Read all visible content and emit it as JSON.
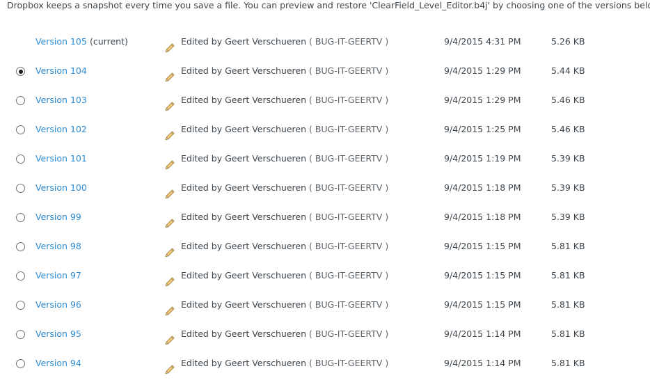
{
  "intro_text": "Dropbox keeps a snapshot every time you save a file. You can preview and restore 'ClearField_Level_Editor.b4j' by choosing one of the versions below:",
  "current_label": "(current)",
  "selected_version": "Version 104",
  "colors": {
    "link": "#2d8bd1",
    "text": "#3d464d",
    "pencil_fill": "#f5c97a",
    "pencil_outline": "#a8894e"
  },
  "icons": {
    "edit": "pencil-icon",
    "radio": "radio-button"
  },
  "versions": [
    {
      "label": "Version 105",
      "current": true,
      "editor": "Edited by Geert Verschueren",
      "host": "( BUG-IT-GEERTV )",
      "date": "9/4/2015 4:31 PM",
      "size": "5.26 KB"
    },
    {
      "label": "Version 104",
      "current": false,
      "editor": "Edited by Geert Verschueren",
      "host": "( BUG-IT-GEERTV )",
      "date": "9/4/2015 1:29 PM",
      "size": "5.44 KB"
    },
    {
      "label": "Version 103",
      "current": false,
      "editor": "Edited by Geert Verschueren",
      "host": "( BUG-IT-GEERTV )",
      "date": "9/4/2015 1:29 PM",
      "size": "5.46 KB"
    },
    {
      "label": "Version 102",
      "current": false,
      "editor": "Edited by Geert Verschueren",
      "host": "( BUG-IT-GEERTV )",
      "date": "9/4/2015 1:25 PM",
      "size": "5.46 KB"
    },
    {
      "label": "Version 101",
      "current": false,
      "editor": "Edited by Geert Verschueren",
      "host": "( BUG-IT-GEERTV )",
      "date": "9/4/2015 1:19 PM",
      "size": "5.39 KB"
    },
    {
      "label": "Version 100",
      "current": false,
      "editor": "Edited by Geert Verschueren",
      "host": "( BUG-IT-GEERTV )",
      "date": "9/4/2015 1:18 PM",
      "size": "5.39 KB"
    },
    {
      "label": "Version 99",
      "current": false,
      "editor": "Edited by Geert Verschueren",
      "host": "( BUG-IT-GEERTV )",
      "date": "9/4/2015 1:18 PM",
      "size": "5.39 KB"
    },
    {
      "label": "Version 98",
      "current": false,
      "editor": "Edited by Geert Verschueren",
      "host": "( BUG-IT-GEERTV )",
      "date": "9/4/2015 1:15 PM",
      "size": "5.81 KB"
    },
    {
      "label": "Version 97",
      "current": false,
      "editor": "Edited by Geert Verschueren",
      "host": "( BUG-IT-GEERTV )",
      "date": "9/4/2015 1:15 PM",
      "size": "5.81 KB"
    },
    {
      "label": "Version 96",
      "current": false,
      "editor": "Edited by Geert Verschueren",
      "host": "( BUG-IT-GEERTV )",
      "date": "9/4/2015 1:15 PM",
      "size": "5.81 KB"
    },
    {
      "label": "Version 95",
      "current": false,
      "editor": "Edited by Geert Verschueren",
      "host": "( BUG-IT-GEERTV )",
      "date": "9/4/2015 1:14 PM",
      "size": "5.81 KB"
    },
    {
      "label": "Version 94",
      "current": false,
      "editor": "Edited by Geert Verschueren",
      "host": "( BUG-IT-GEERTV )",
      "date": "9/4/2015 1:14 PM",
      "size": "5.81 KB"
    }
  ]
}
